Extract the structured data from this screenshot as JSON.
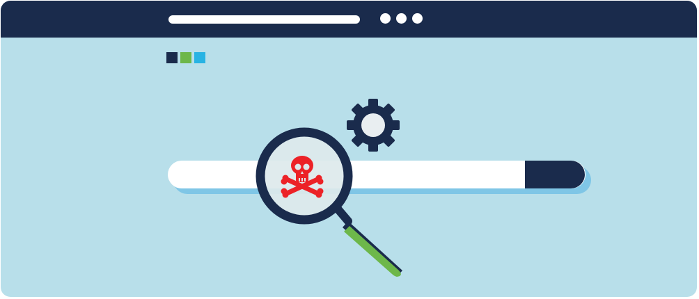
{
  "colors": {
    "navy": "#1a2b4c",
    "page_background": "#b8dfea",
    "light_blue": "#7fc6e6",
    "green": "#6db74a",
    "cyan": "#28b3e3",
    "danger_red": "#ec2227",
    "white": "#ffffff"
  },
  "browser": {
    "address_bar": "",
    "window_controls": [
      "dot",
      "dot",
      "dot"
    ]
  },
  "brand_squares": [
    "#1a2b4c",
    "#6db74a",
    "#28b3e3"
  ],
  "search": {
    "value": "",
    "placeholder": ""
  },
  "icons": {
    "settings": "gear-icon",
    "inspect": "magnifying-glass-icon",
    "threat": "skull-crossbones-icon"
  }
}
